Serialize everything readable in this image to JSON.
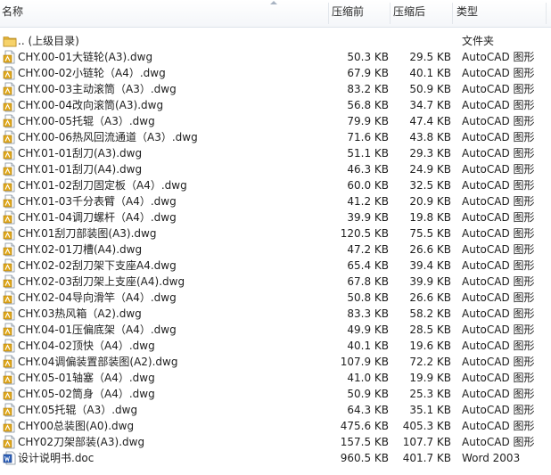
{
  "columns": {
    "name": "名称",
    "compressed": "压缩前",
    "uncompressed": "压缩后",
    "type": "类型"
  },
  "rows": [
    {
      "kind": "folder",
      "name": ".. (上级目录)",
      "compressed": "",
      "uncompressed": "",
      "type": "文件夹"
    },
    {
      "kind": "dwg",
      "name": "CHY.00-01大链轮(A3).dwg",
      "compressed": "50.3 KB",
      "uncompressed": "29.5 KB",
      "type": "AutoCAD 图形"
    },
    {
      "kind": "dwg",
      "name": "CHY.00-02小链轮（A4）.dwg",
      "compressed": "67.9 KB",
      "uncompressed": "40.1 KB",
      "type": "AutoCAD 图形"
    },
    {
      "kind": "dwg",
      "name": "CHY.00-03主动滚筒（A3）.dwg",
      "compressed": "83.2 KB",
      "uncompressed": "50.9 KB",
      "type": "AutoCAD 图形"
    },
    {
      "kind": "dwg",
      "name": "CHY.00-04改向滚筒(A3).dwg",
      "compressed": "56.8 KB",
      "uncompressed": "34.7 KB",
      "type": "AutoCAD 图形"
    },
    {
      "kind": "dwg",
      "name": "CHY.00-05托辊（A3）.dwg",
      "compressed": "79.9 KB",
      "uncompressed": "47.4 KB",
      "type": "AutoCAD 图形"
    },
    {
      "kind": "dwg",
      "name": "CHY.00-06热风回流通道（A3）.dwg",
      "compressed": "71.6 KB",
      "uncompressed": "43.8 KB",
      "type": "AutoCAD 图形"
    },
    {
      "kind": "dwg",
      "name": "CHY.01-01刮刀(A3).dwg",
      "compressed": "51.1 KB",
      "uncompressed": "29.3 KB",
      "type": "AutoCAD 图形"
    },
    {
      "kind": "dwg",
      "name": "CHY.01-01刮刀(A4).dwg",
      "compressed": "46.3 KB",
      "uncompressed": "24.9 KB",
      "type": "AutoCAD 图形"
    },
    {
      "kind": "dwg",
      "name": "CHY.01-02刮刀固定板（A4）.dwg",
      "compressed": "60.0 KB",
      "uncompressed": "32.5 KB",
      "type": "AutoCAD 图形"
    },
    {
      "kind": "dwg",
      "name": "CHY.01-03千分表臂（A4）.dwg",
      "compressed": "41.2 KB",
      "uncompressed": "20.9 KB",
      "type": "AutoCAD 图形"
    },
    {
      "kind": "dwg",
      "name": "CHY.01-04调刀螺杆（A4）.dwg",
      "compressed": "39.9 KB",
      "uncompressed": "19.8 KB",
      "type": "AutoCAD 图形"
    },
    {
      "kind": "dwg",
      "name": "CHY.01刮刀部装图(A3).dwg",
      "compressed": "120.5 KB",
      "uncompressed": "75.5 KB",
      "type": "AutoCAD 图形"
    },
    {
      "kind": "dwg",
      "name": "CHY.02-01刀槽(A4).dwg",
      "compressed": "47.2 KB",
      "uncompressed": "26.6 KB",
      "type": "AutoCAD 图形"
    },
    {
      "kind": "dwg",
      "name": "CHY.02-02刮刀架下支座A4.dwg",
      "compressed": "65.4 KB",
      "uncompressed": "39.4 KB",
      "type": "AutoCAD 图形"
    },
    {
      "kind": "dwg",
      "name": "CHY.02-03刮刀架上支座(A4).dwg",
      "compressed": "67.8 KB",
      "uncompressed": "39.9 KB",
      "type": "AutoCAD 图形"
    },
    {
      "kind": "dwg",
      "name": "CHY.02-04导向滑竿（A4）.dwg",
      "compressed": "50.8 KB",
      "uncompressed": "26.6 KB",
      "type": "AutoCAD 图形"
    },
    {
      "kind": "dwg",
      "name": "CHY.03热风箱（A2).dwg",
      "compressed": "83.3 KB",
      "uncompressed": "58.2 KB",
      "type": "AutoCAD 图形"
    },
    {
      "kind": "dwg",
      "name": "CHY.04-01压偏底架（A4）.dwg",
      "compressed": "49.9 KB",
      "uncompressed": "28.5 KB",
      "type": "AutoCAD 图形"
    },
    {
      "kind": "dwg",
      "name": "CHY.04-02顶快（A4）.dwg",
      "compressed": "40.1 KB",
      "uncompressed": "19.6 KB",
      "type": "AutoCAD 图形"
    },
    {
      "kind": "dwg",
      "name": "CHY.04调偏装置部装图(A2).dwg",
      "compressed": "107.9 KB",
      "uncompressed": "72.2 KB",
      "type": "AutoCAD 图形"
    },
    {
      "kind": "dwg",
      "name": "CHY.05-01轴塞（A4）.dwg",
      "compressed": "41.0 KB",
      "uncompressed": "19.9 KB",
      "type": "AutoCAD 图形"
    },
    {
      "kind": "dwg",
      "name": "CHY.05-02筒身（A4）.dwg",
      "compressed": "50.9 KB",
      "uncompressed": "25.3 KB",
      "type": "AutoCAD 图形"
    },
    {
      "kind": "dwg",
      "name": "CHY.05托辊（A3）.dwg",
      "compressed": "64.3 KB",
      "uncompressed": "35.1 KB",
      "type": "AutoCAD 图形"
    },
    {
      "kind": "dwg",
      "name": "CHY00总装图(A0).dwg",
      "compressed": "475.6 KB",
      "uncompressed": "405.3 KB",
      "type": "AutoCAD 图形"
    },
    {
      "kind": "dwg",
      "name": "CHY02刀架部装(A3).dwg",
      "compressed": "157.5 KB",
      "uncompressed": "107.7 KB",
      "type": "AutoCAD 图形"
    },
    {
      "kind": "doc",
      "name": "设计说明书.doc",
      "compressed": "960.5 KB",
      "uncompressed": "401.7 KB",
      "type": "Word 2003"
    }
  ]
}
